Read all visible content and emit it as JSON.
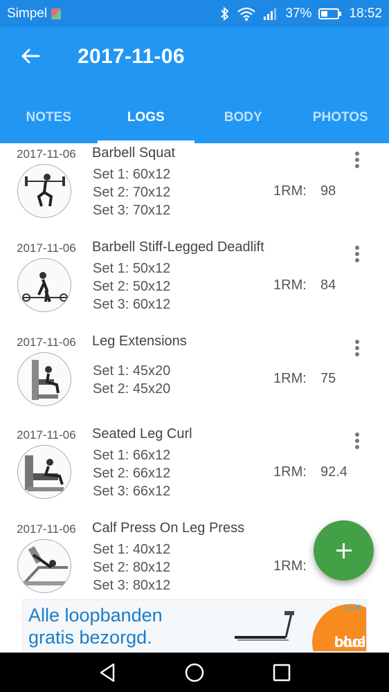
{
  "status_bar": {
    "carrier": "Simpel",
    "battery": "37%",
    "time": "18:52"
  },
  "header": {
    "title": "2017-11-06"
  },
  "tabs": [
    {
      "label": "NOTES",
      "active": false
    },
    {
      "label": "LOGS",
      "active": true
    },
    {
      "label": "BODY",
      "active": false
    },
    {
      "label": "PHOTOS",
      "active": false
    }
  ],
  "rm_label": "1RM:",
  "entries": [
    {
      "date": "2017-11-06",
      "name": "Barbell Squat",
      "sets": [
        "Set 1: 60x12",
        "Set 2: 70x12",
        "Set 3: 70x12"
      ],
      "one_rm": "98",
      "icon": "barbell-squat-icon"
    },
    {
      "date": "2017-11-06",
      "name": "Barbell Stiff-Legged Deadlift",
      "sets": [
        "Set 1: 50x12",
        "Set 2: 50x12",
        "Set 3: 60x12"
      ],
      "one_rm": "84",
      "icon": "deadlift-icon"
    },
    {
      "date": "2017-11-06",
      "name": "Leg Extensions",
      "sets": [
        "Set 1: 45x20",
        "Set 2: 45x20"
      ],
      "one_rm": "75",
      "icon": "leg-extension-machine-icon"
    },
    {
      "date": "2017-11-06",
      "name": "Seated Leg Curl",
      "sets": [
        "Set 1: 66x12",
        "Set 2: 66x12",
        "Set 3: 66x12"
      ],
      "one_rm": "92.4",
      "icon": "leg-curl-machine-icon"
    },
    {
      "date": "2017-11-06",
      "name": "Calf Press On Leg Press",
      "sets": [
        "Set 1: 40x12",
        "Set 2: 80x12",
        "Set 3: 80x12"
      ],
      "one_rm": "",
      "icon": "leg-press-machine-icon"
    }
  ],
  "fab": {
    "icon": "plus-icon"
  },
  "ad": {
    "headline_line1": "Alle loopbanden",
    "headline_line2": "gratis bezorgd.",
    "brand_line1": "cool",
    "brand_line2": "blue",
    "choices_icon": "ad-choices-icon"
  },
  "colors": {
    "app_bar": "#2196f3",
    "status_bar": "#1e88e5",
    "fab": "#43a047",
    "ad_text": "#1c7cc4",
    "ad_logo": "#f78b1f"
  }
}
